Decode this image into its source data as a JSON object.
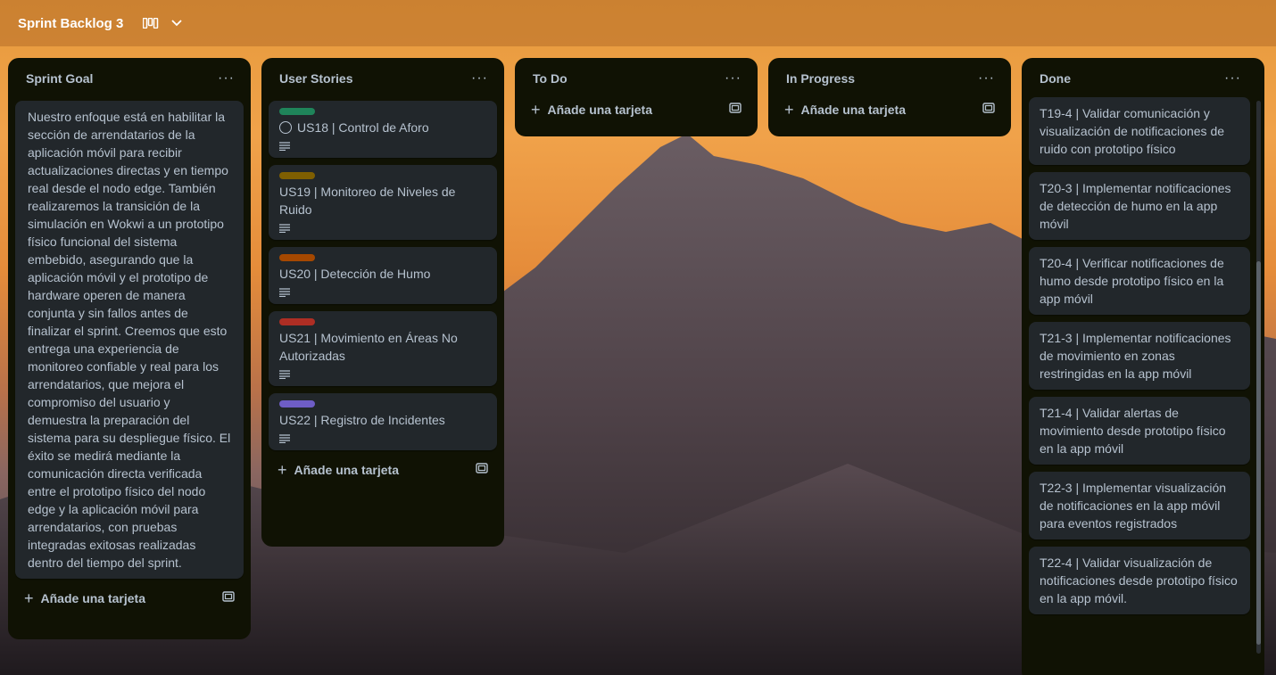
{
  "board": {
    "title": "Sprint Backlog 3"
  },
  "lists": {
    "sprint_goal": {
      "title": "Sprint Goal",
      "card_text": "Nuestro enfoque está en habilitar la sección de arrendatarios de la aplicación móvil para recibir actualizaciones directas y en tiempo real desde el nodo edge. También realizaremos la transición de la simulación en Wokwi a un prototipo físico funcional del sistema embebido, asegurando que la aplicación móvil y el prototipo de hardware operen de manera conjunta y sin fallos antes de finalizar el sprint. Creemos que esto entrega una experiencia de monitoreo confiable y real para los arrendatarios, que mejora el compromiso del usuario y demuestra la preparación del sistema para su despliegue físico. El éxito se medirá mediante la comunicación directa verificada entre el prototipo físico del nodo edge y la aplicación móvil para arrendatarios, con pruebas integradas exitosas realizadas dentro del tiempo del sprint.",
      "add_label": "Añade una tarjeta"
    },
    "user_stories": {
      "title": "User Stories",
      "cards": [
        {
          "title": "US18 | Control de Aforo",
          "label_color": "#1f845a"
        },
        {
          "title": "US19 | Monitoreo de Niveles de Ruido",
          "label_color": "#7f5f01"
        },
        {
          "title": "US20 | Detección de Humo",
          "label_color": "#a54800"
        },
        {
          "title": "US21 | Movimiento en Áreas No Autorizadas",
          "label_color": "#ae2e24"
        },
        {
          "title": "US22 | Registro de Incidentes",
          "label_color": "#6e5dc6"
        }
      ],
      "add_label": "Añade una tarjeta"
    },
    "todo": {
      "title": "To Do",
      "add_label": "Añade una tarjeta"
    },
    "in_progress": {
      "title": "In Progress",
      "add_label": "Añade una tarjeta"
    },
    "done": {
      "title": "Done",
      "cards": [
        {
          "title": "T19-4 | Validar comunicación y visualización de notificaciones de ruido con prototipo físico"
        },
        {
          "title": "T20-3 | Implementar notificaciones de detección de humo en la app móvil"
        },
        {
          "title": "T20-4 | Verificar notificaciones de humo desde prototipo físico en la app móvil"
        },
        {
          "title": "T21-3 | Implementar notificaciones de movimiento en zonas restringidas en la app móvil"
        },
        {
          "title": "T21-4 | Validar alertas de movimiento desde prototipo físico en la app móvil"
        },
        {
          "title": "T22-3 | Implementar visualización de notificaciones en la app móvil para eventos registrados"
        },
        {
          "title": "T22-4 | Validar visualización de notificaciones desde prototipo físico en la app móvil."
        }
      ]
    }
  },
  "menu_glyph": "···",
  "icons": [
    "board-view-icon",
    "chevron-down-icon",
    "more-icon",
    "plus-icon",
    "template-icon",
    "description-icon"
  ]
}
